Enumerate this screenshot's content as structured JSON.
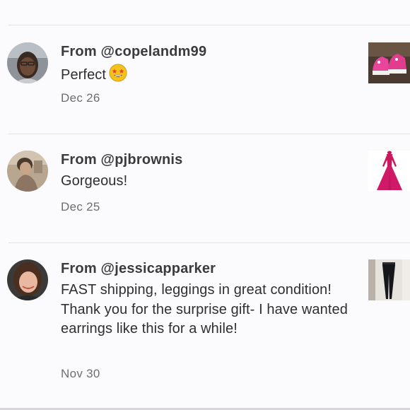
{
  "reviews": [
    {
      "from": "From @copelandm99",
      "text": "Perfect",
      "emoji": "star-struck-emoji",
      "date": "Dec 26",
      "avatar": "user-avatar-copelandm99",
      "item_image": "pink-sneakers-image"
    },
    {
      "from": "From @pjbrownis",
      "text": "Gorgeous!",
      "date": "Dec 25",
      "avatar": "user-avatar-pjbrownis",
      "item_image": "magenta-dress-image"
    },
    {
      "from": "From @jessicapparker",
      "text": "FAST shipping, leggings in great condition! Thank you for the surprise gift- I have wanted earrings like this for a while!",
      "date": "Nov 30",
      "avatar": "user-avatar-jessicapparker",
      "item_image": "black-leggings-image"
    }
  ],
  "colors": {
    "background": "#fbfafc",
    "divider": "#e4e2e6",
    "text_primary": "#2f2e31",
    "text_secondary": "#6e6d72"
  }
}
